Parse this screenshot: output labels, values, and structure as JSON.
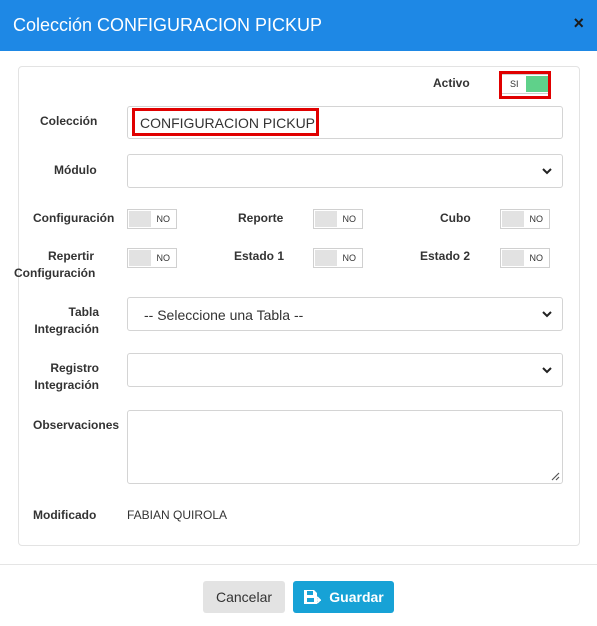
{
  "dialog": {
    "title": "Colección CONFIGURACION PICKUP",
    "close_glyph": "×"
  },
  "form": {
    "activo": {
      "label": "Activo",
      "state": "SI"
    },
    "coleccion": {
      "label": "Colección",
      "value": "CONFIGURACION PICKUP"
    },
    "modulo": {
      "label": "Módulo",
      "value": ""
    },
    "configuracion": {
      "label": "Configuración",
      "state": "NO"
    },
    "reporte": {
      "label": "Reporte",
      "state": "NO"
    },
    "cubo": {
      "label": "Cubo",
      "state": "NO"
    },
    "repertir": {
      "label_line1": "Repertir",
      "label_line2": "Configuración",
      "state": "NO"
    },
    "estado1": {
      "label": "Estado 1",
      "state": "NO"
    },
    "estado2": {
      "label": "Estado 2",
      "state": "NO"
    },
    "tabla": {
      "label_line1": "Tabla",
      "label_line2": "Integración",
      "value": "-- Seleccione una Tabla --"
    },
    "registro": {
      "label_line1": "Registro",
      "label_line2": "Integración",
      "value": ""
    },
    "observaciones": {
      "label": "Observaciones",
      "value": ""
    },
    "modificado": {
      "label": "Modificado",
      "value": "FABIAN QUIROLA"
    }
  },
  "footer": {
    "cancel_label": "Cancelar",
    "save_label": "Guardar"
  },
  "colors": {
    "header": "#1e88e5",
    "toggle_on": "#5fd18a",
    "save_button": "#17a2d6",
    "highlight": "#e00000"
  },
  "icons": [
    "close-icon",
    "chevron-down-icon",
    "save-icon",
    "resize-grip-icon"
  ]
}
